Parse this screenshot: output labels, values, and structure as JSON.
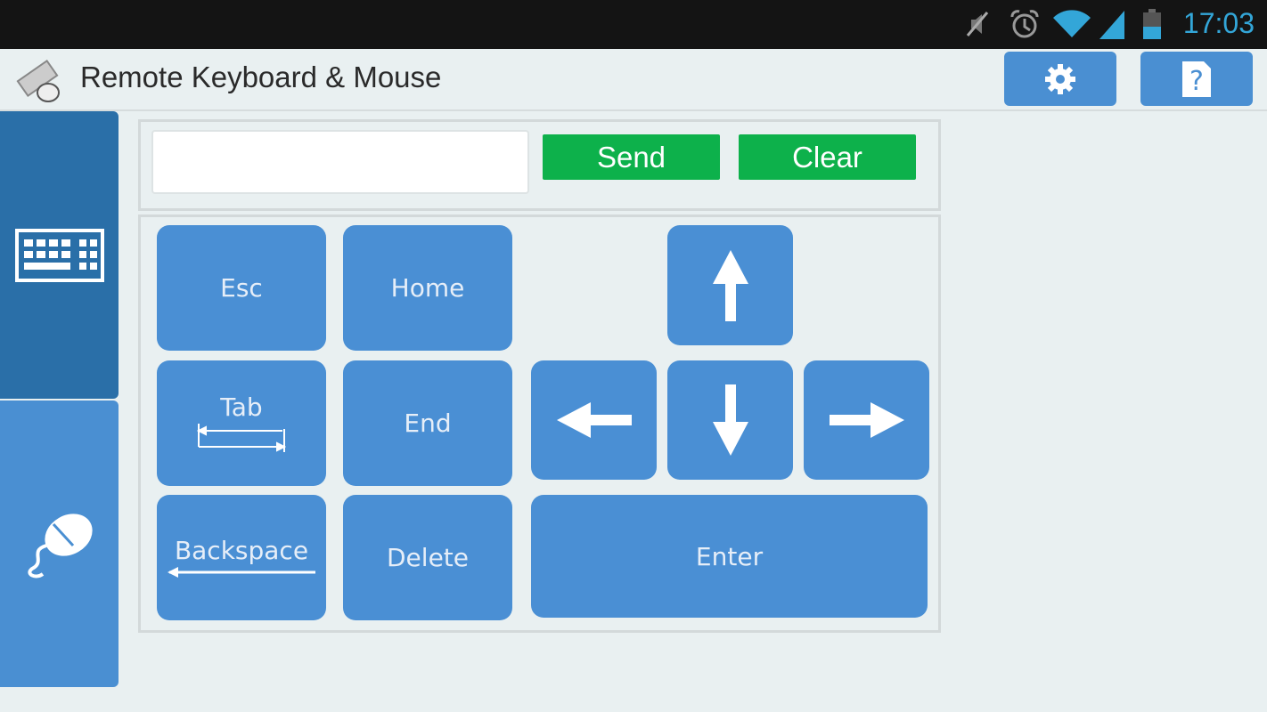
{
  "status_bar": {
    "time": "17:03",
    "icons": [
      "mute-icon",
      "alarm-icon",
      "wifi-icon",
      "signal-icon",
      "battery-icon"
    ]
  },
  "app_bar": {
    "title": "Remote Keyboard & Mouse",
    "icons": [
      "app-logo-icon",
      "settings-gear-icon",
      "help-icon"
    ]
  },
  "sidebar": {
    "tabs": [
      {
        "name": "keyboard",
        "icon": "keyboard-icon",
        "selected": true
      },
      {
        "name": "mouse",
        "icon": "mouse-icon",
        "selected": false
      }
    ]
  },
  "input_row": {
    "text_value": "",
    "placeholder": "",
    "send_label": "Send",
    "clear_label": "Clear"
  },
  "keys": {
    "esc": "Esc",
    "home": "Home",
    "tab": "Tab",
    "end": "End",
    "backspace": "Backspace",
    "delete": "Delete",
    "enter": "Enter"
  },
  "colors": {
    "key": "#4a8fd4",
    "selected_tab": "#2a6fa8",
    "green_button": "#0db14b",
    "clock": "#33a6d8"
  }
}
